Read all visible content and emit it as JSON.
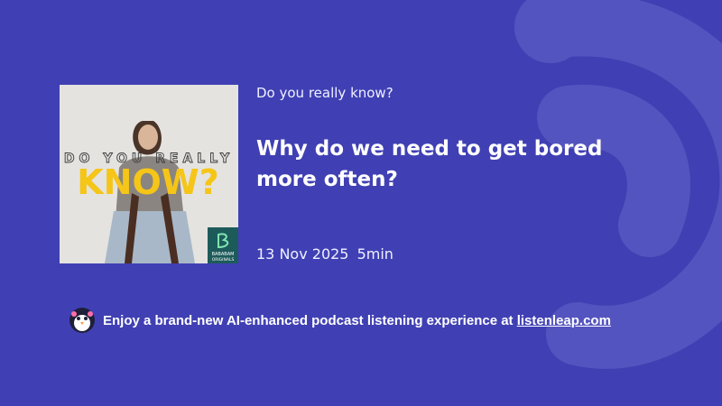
{
  "background_color": "#4040b4",
  "episode": {
    "show_name": "Do you really know?",
    "title": "Why do we need to get bored more often?",
    "date": "13 Nov 2025",
    "duration": "5min"
  },
  "cover": {
    "headline_small": "DO YOU REALLY",
    "headline_big": "KNOW?",
    "badge_line": "BABABAM",
    "badge_line2": "ORIGINALS",
    "headline_color": "#f5c518"
  },
  "promo": {
    "icon": "penguin-icon",
    "text": "Enjoy a brand-new AI-enhanced podcast listening experience at ",
    "link_text": "listenleap.com"
  }
}
